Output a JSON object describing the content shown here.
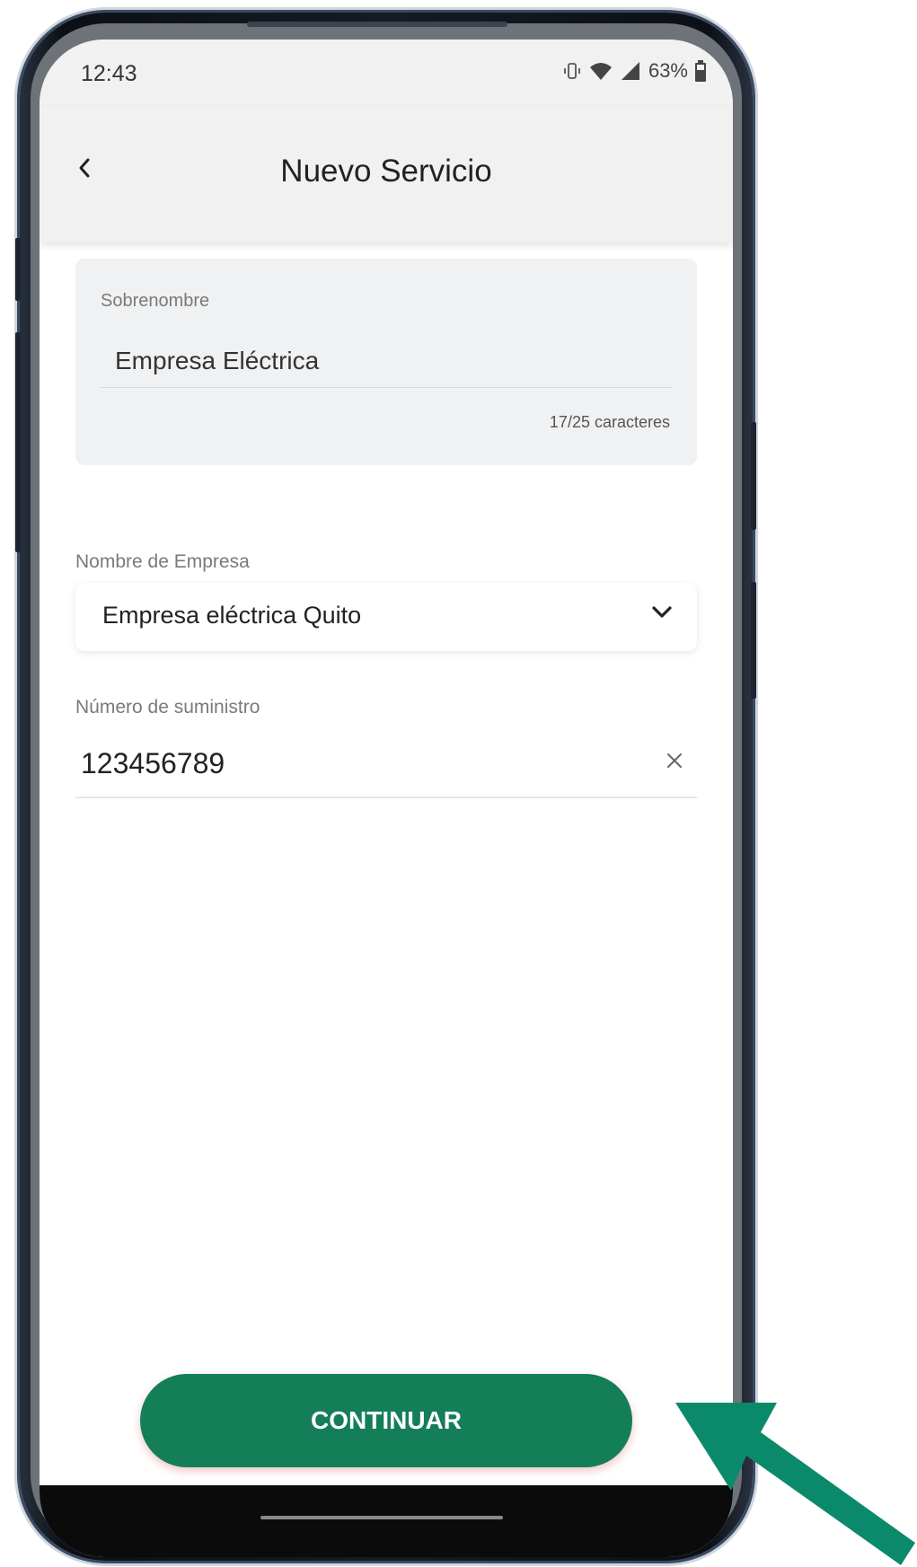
{
  "status_bar": {
    "time": "12:43",
    "battery": "63%",
    "icons": [
      "vibrate-icon",
      "wifi-icon",
      "signal-icon",
      "battery-icon"
    ]
  },
  "app_bar": {
    "title": "Nuevo Servicio",
    "back_icon": "back-chevron-icon"
  },
  "form": {
    "nickname": {
      "label": "Sobrenombre",
      "value": "Empresa Eléctrica",
      "counter": "17/25 caracteres"
    },
    "company": {
      "label": "Nombre de Empresa",
      "value": "Empresa eléctrica Quito",
      "icon": "chevron-down-icon"
    },
    "supply_number": {
      "label": "Número de suministro",
      "value": "123456789",
      "clear_icon": "clear-icon"
    }
  },
  "actions": {
    "continue_label": "CONTINUAR"
  },
  "colors": {
    "primary": "#137e58",
    "pointer_arrow": "#0b8a6b",
    "header_bg": "#f1f1f1",
    "card_bg": "#f0f1f2"
  }
}
